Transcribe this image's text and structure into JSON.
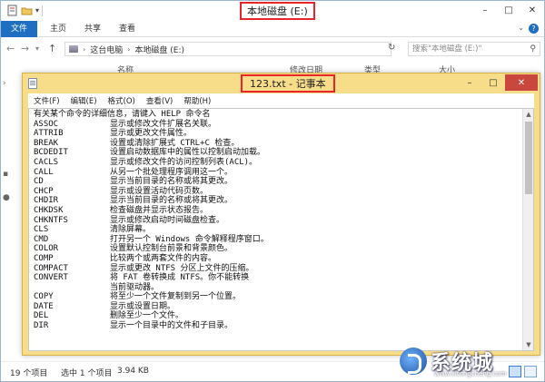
{
  "explorer": {
    "window_title": "本地磁盘 (E:)",
    "ribbon_tabs": [
      "文件",
      "主页",
      "共享",
      "查看"
    ],
    "breadcrumb": [
      "这台电脑",
      "本地磁盘 (E:)"
    ],
    "search_placeholder": "搜索\"本地磁盘 (E:)\"",
    "column_headers": [
      "名称",
      "修改日期",
      "类型",
      "大小"
    ],
    "status": {
      "item_count": "19 个项目",
      "selected": "选中 1 个项目",
      "size": "3.94 KB"
    }
  },
  "notepad": {
    "title": "123.txt - 记事本",
    "menu": [
      "文件(F)",
      "编辑(E)",
      "格式(O)",
      "查看(V)",
      "帮助(H)"
    ],
    "lines": [
      {
        "cmd": "有关某个命令的详细信息，请键入 HELP 命令名",
        "desc": "",
        "full": true
      },
      {
        "cmd": "ASSOC",
        "desc": "显示或修改文件扩展名关联。"
      },
      {
        "cmd": "ATTRIB",
        "desc": "显示或更改文件属性。"
      },
      {
        "cmd": "BREAK",
        "desc": "设置或清除扩展式 CTRL+C 检查。"
      },
      {
        "cmd": "BCDEDIT",
        "desc": "设置启动数据库中的属性以控制启动加载。"
      },
      {
        "cmd": "CACLS",
        "desc": "显示或修改文件的访问控制列表(ACL)。"
      },
      {
        "cmd": "CALL",
        "desc": "从另一个批处理程序调用这一个。"
      },
      {
        "cmd": "CD",
        "desc": "显示当前目录的名称或将其更改。"
      },
      {
        "cmd": "CHCP",
        "desc": "显示或设置活动代码页数。"
      },
      {
        "cmd": "CHDIR",
        "desc": "显示当前目录的名称或将其更改。"
      },
      {
        "cmd": "CHKDSK",
        "desc": "检查磁盘并显示状态报告。"
      },
      {
        "cmd": "CHKNTFS",
        "desc": "显示或修改启动时间磁盘检查。"
      },
      {
        "cmd": "CLS",
        "desc": "清除屏幕。"
      },
      {
        "cmd": "CMD",
        "desc": "打开另一个 Windows 命令解释程序窗口。"
      },
      {
        "cmd": "COLOR",
        "desc": "设置默认控制台前景和背景颜色。"
      },
      {
        "cmd": "COMP",
        "desc": "比较两个或两套文件的内容。"
      },
      {
        "cmd": "COMPACT",
        "desc": "显示或更改 NTFS 分区上文件的压缩。"
      },
      {
        "cmd": "CONVERT",
        "desc": "将 FAT 卷转换成 NTFS。你不能转换"
      },
      {
        "cmd": "",
        "desc": "当前驱动器。"
      },
      {
        "cmd": "COPY",
        "desc": "将至少一个文件复制到另一个位置。"
      },
      {
        "cmd": "DATE",
        "desc": "显示或设置日期。"
      },
      {
        "cmd": "DEL",
        "desc": "删除至少一个文件。"
      },
      {
        "cmd": "DIR",
        "desc": "显示一个目录中的文件和子目录。"
      }
    ]
  },
  "watermark": {
    "text": "系统城",
    "sub": "www.xitongcheng.com"
  },
  "colors": {
    "accent": "#1e6fc1",
    "highlight": "#e8262a",
    "notepad_frame": "#f7dc8a"
  }
}
